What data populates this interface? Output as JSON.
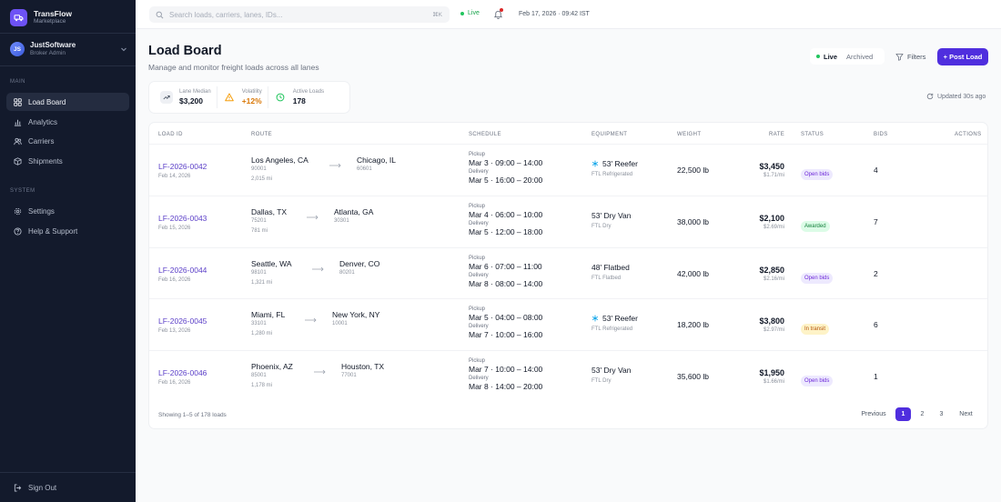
{
  "app": {
    "name": "TransFlow",
    "subtitle": "Marketplace",
    "brand_color": "#6d52f5"
  },
  "account": {
    "initials": "JS",
    "name": "JustSoftware",
    "role": "Broker Admin"
  },
  "sidebar": {
    "sections": [
      "MAIN",
      "SYSTEM"
    ],
    "main_items": [
      {
        "label": "Load Board",
        "icon": "grid-icon",
        "active": true
      },
      {
        "label": "Analytics",
        "icon": "bar-chart-icon"
      },
      {
        "label": "Carriers",
        "icon": "users-icon"
      },
      {
        "label": "Shipments",
        "icon": "box-icon"
      }
    ],
    "system_items": [
      {
        "label": "Settings",
        "icon": "gear-icon"
      },
      {
        "label": "Help & Support",
        "icon": "help-icon"
      }
    ],
    "sign_out": "Sign Out"
  },
  "topbar": {
    "search_placeholder": "Search loads, carriers, lanes, IDs...",
    "shortcut": "⌘K",
    "live": "Live",
    "datetime": "Feb 17, 2026 · 09:42 IST"
  },
  "header": {
    "title": "Load Board",
    "subtitle": "Manage and monitor freight loads across all lanes",
    "tabs": [
      "Live",
      "Archived"
    ],
    "filters": "Filters",
    "post_button": "+ Post Load",
    "updated": "Updated 30s ago"
  },
  "stats": [
    {
      "label": "Lane Median",
      "value": "$3,200",
      "color": "#111827"
    },
    {
      "label": "Volatility",
      "value": "+12%",
      "color": "#d97706"
    },
    {
      "label": "Active Loads",
      "value": "178",
      "color": "#111827"
    }
  ],
  "table": {
    "columns": [
      "LOAD ID",
      "ROUTE",
      "SCHEDULE",
      "EQUIPMENT",
      "WEIGHT",
      "RATE",
      "STATUS",
      "BIDS",
      "ACTIONS"
    ],
    "rows": [
      {
        "id": "LF-2026-0042",
        "date": "Feb 14, 2026",
        "origin": "Los Angeles, CA",
        "origin_zip": "90001",
        "dest": "Chicago, IL",
        "dest_zip": "60601",
        "miles": "2,015 mi",
        "pickup_label": "Pickup",
        "pickup": "Mar 3 · 09:00 – 14:00",
        "delivery_label": "Delivery",
        "delivery": "Mar 5 · 16:00 – 20:00",
        "equipment": "53' Reefer",
        "equipment_sub": "FTL Refrigerated",
        "reefer": true,
        "weight": "22,500 lb",
        "rate": "$3,450",
        "per_mile": "$1.71/mi",
        "status": "Open bids",
        "status_kind": "open",
        "bids": "4"
      },
      {
        "id": "LF-2026-0043",
        "date": "Feb 15, 2026",
        "origin": "Dallas, TX",
        "origin_zip": "75201",
        "dest": "Atlanta, GA",
        "dest_zip": "30301",
        "miles": "781 mi",
        "pickup_label": "Pickup",
        "pickup": "Mar 4 · 06:00 – 10:00",
        "delivery_label": "Delivery",
        "delivery": "Mar 5 · 12:00 – 18:00",
        "equipment": "53' Dry Van",
        "equipment_sub": "FTL Dry",
        "reefer": false,
        "weight": "38,000 lb",
        "rate": "$2,100",
        "per_mile": "$2.69/mi",
        "status": "Awarded",
        "status_kind": "awarded",
        "bids": "7"
      },
      {
        "id": "LF-2026-0044",
        "date": "Feb 16, 2026",
        "origin": "Seattle, WA",
        "origin_zip": "98101",
        "dest": "Denver, CO",
        "dest_zip": "80201",
        "miles": "1,321 mi",
        "pickup_label": "Pickup",
        "pickup": "Mar 6 · 07:00 – 11:00",
        "delivery_label": "Delivery",
        "delivery": "Mar 8 · 08:00 – 14:00",
        "equipment": "48' Flatbed",
        "equipment_sub": "FTL Flatbed",
        "reefer": false,
        "weight": "42,000 lb",
        "rate": "$2,850",
        "per_mile": "$2.16/mi",
        "status": "Open bids",
        "status_kind": "open",
        "bids": "2"
      },
      {
        "id": "LF-2026-0045",
        "date": "Feb 13, 2026",
        "origin": "Miami, FL",
        "origin_zip": "33101",
        "dest": "New York, NY",
        "dest_zip": "10001",
        "miles": "1,280 mi",
        "pickup_label": "Pickup",
        "pickup": "Mar 5 · 04:00 – 08:00",
        "delivery_label": "Delivery",
        "delivery": "Mar 7 · 10:00 – 16:00",
        "equipment": "53' Reefer",
        "equipment_sub": "FTL Refrigerated",
        "reefer": true,
        "weight": "18,200 lb",
        "rate": "$3,800",
        "per_mile": "$2.97/mi",
        "status": "In transit",
        "status_kind": "transit",
        "bids": "6"
      },
      {
        "id": "LF-2026-0046",
        "date": "Feb 16, 2026",
        "origin": "Phoenix, AZ",
        "origin_zip": "85001",
        "dest": "Houston, TX",
        "dest_zip": "77001",
        "miles": "1,178 mi",
        "pickup_label": "Pickup",
        "pickup": "Mar 7 · 10:00 – 14:00",
        "delivery_label": "Delivery",
        "delivery": "Mar 8 · 14:00 – 20:00",
        "equipment": "53' Dry Van",
        "equipment_sub": "FTL Dry",
        "reefer": false,
        "weight": "35,600 lb",
        "rate": "$1,950",
        "per_mile": "$1.66/mi",
        "status": "Open bids",
        "status_kind": "open",
        "bids": "1"
      }
    ],
    "footer": "Showing 1–5 of 178 loads",
    "pagination": [
      "Previous",
      "1",
      "2",
      "3",
      "Next"
    ],
    "current_page": "1"
  },
  "colors": {
    "accent": "#4f2ede",
    "sidebar_bg": "#131a2c",
    "live_green": "#22c55e",
    "open_bg": "#ede9fe",
    "open_fg": "#6d28d9",
    "awarded_bg": "#dcfce7",
    "awarded_fg": "#15803d",
    "transit_bg": "#fef3c7",
    "transit_fg": "#b45309"
  }
}
